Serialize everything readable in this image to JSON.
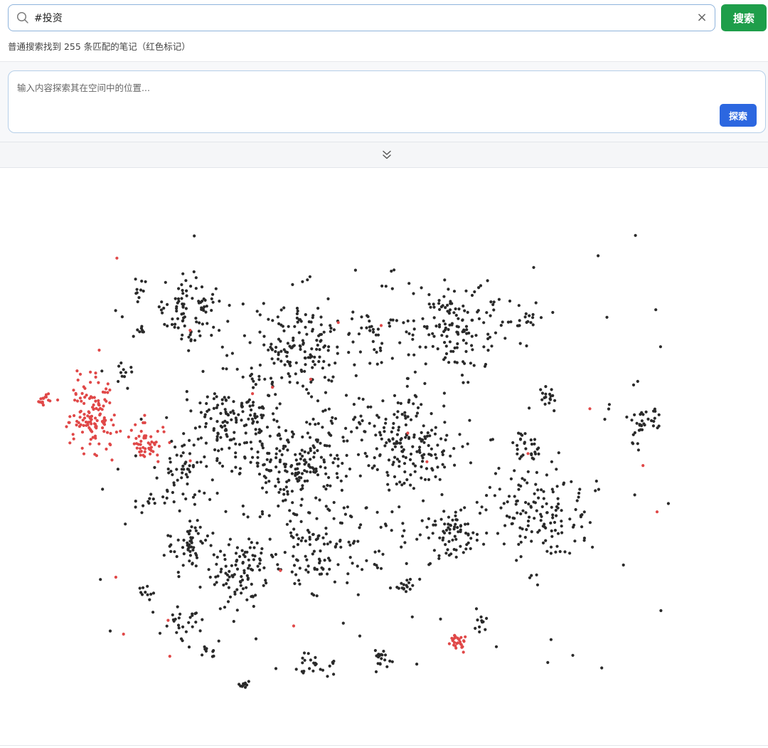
{
  "search": {
    "value": "#投资",
    "button_label": "搜索",
    "clear_icon": "×"
  },
  "result": {
    "text": "普通搜索找到 255 条匹配的笔记（红色标记）"
  },
  "explore": {
    "placeholder": "输入内容探索其在空间中的位置...",
    "button_label": "探索"
  },
  "colors": {
    "accent_green": "#1e9e4a",
    "accent_blue": "#2c67e0",
    "match_point": "#e04848",
    "normal_point": "#2a2a2a"
  },
  "map": {
    "icons": [
      "search-icon",
      "clear-icon",
      "chevron-double-down-icon"
    ],
    "legend_note": "红色标记 = matching notes"
  }
}
